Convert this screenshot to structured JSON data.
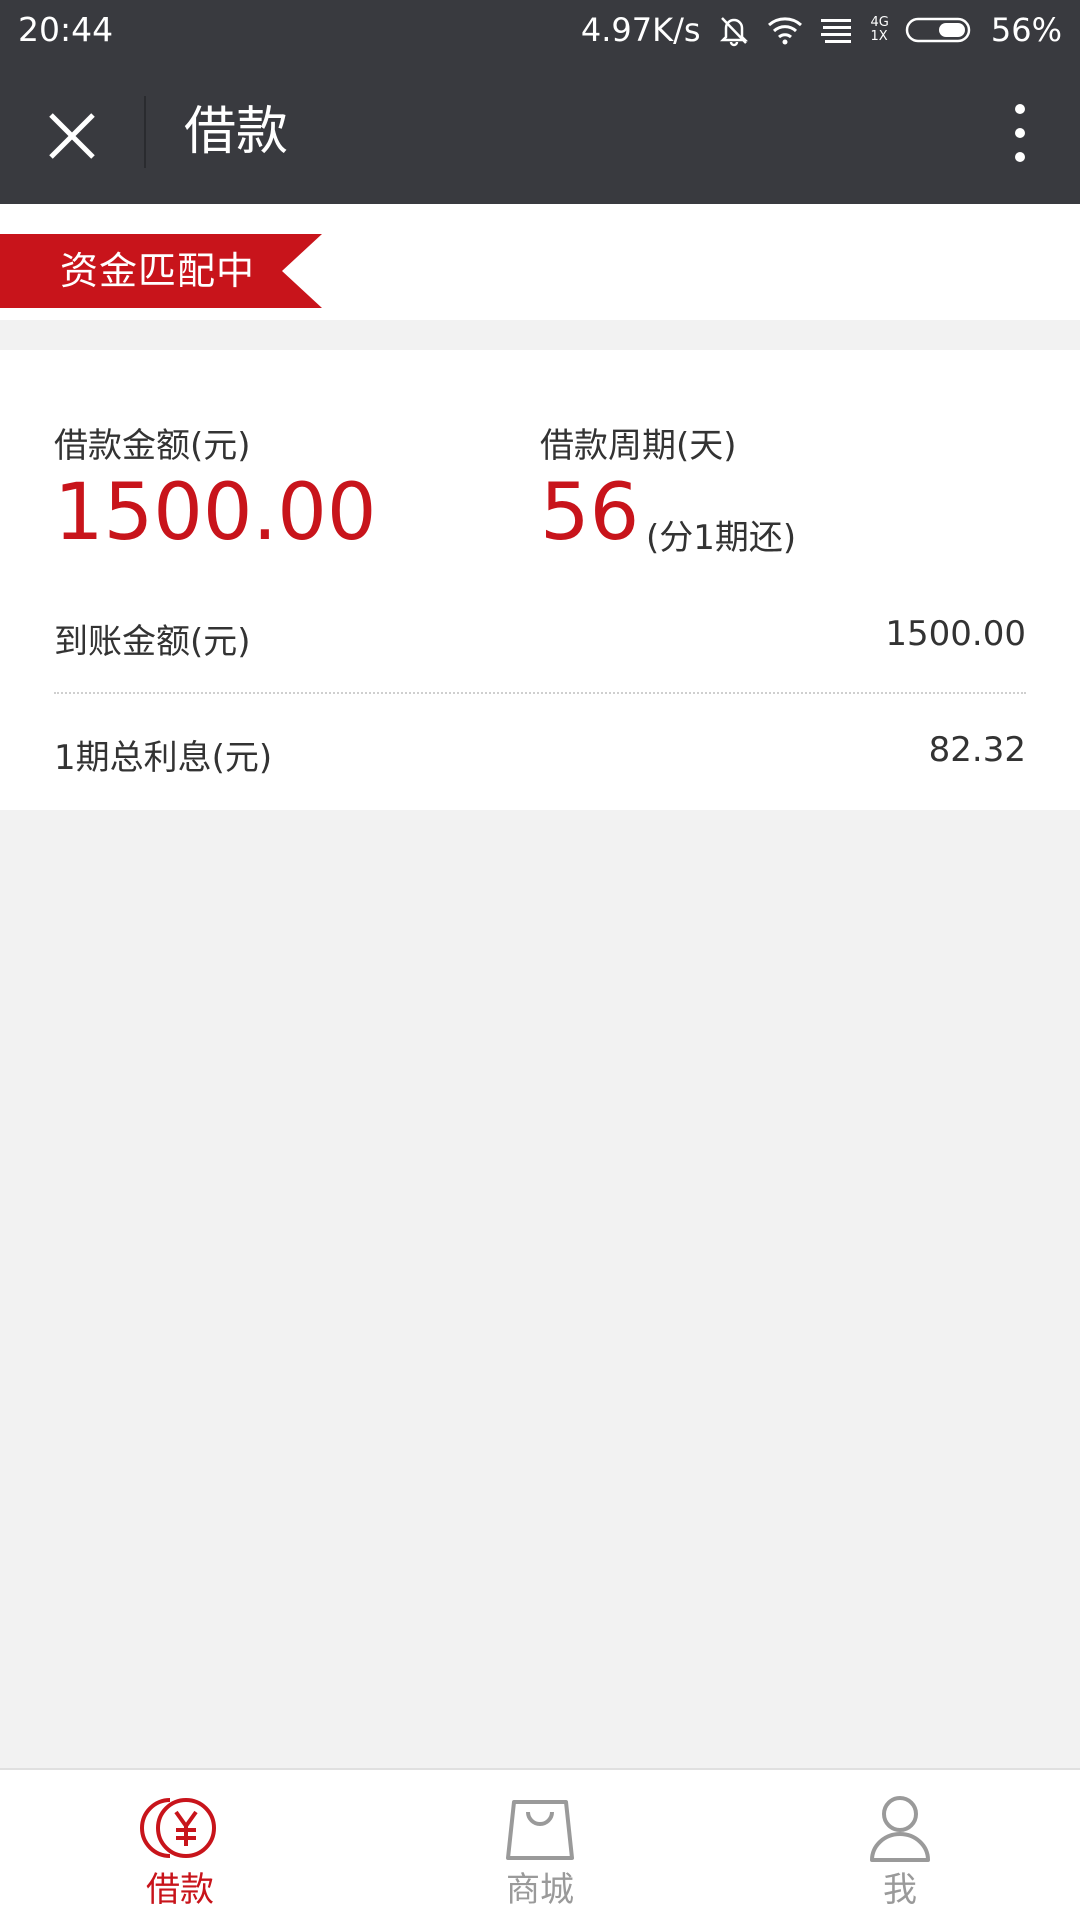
{
  "status_bar": {
    "time": "20:44",
    "net_speed": "4.97K/s",
    "network_type_top": "4G",
    "network_type_bottom": "1X",
    "battery": "56%"
  },
  "title_bar": {
    "title": "借款"
  },
  "status_ribbon": {
    "text": "资金匹配中",
    "color": "#c8141b"
  },
  "loan": {
    "amount_label": "借款金额(元)",
    "amount_value": "1500.00",
    "term_label": "借款周期(天)",
    "term_value": "56",
    "term_note": "(分1期还)",
    "received_label": "到账金额(元)",
    "received_value": "1500.00",
    "interest_label": "1期总利息(元)",
    "interest_value": "82.32"
  },
  "tab_bar": {
    "tabs": [
      {
        "label": "借款",
        "icon": "yuan-coin-icon",
        "active": true
      },
      {
        "label": "商城",
        "icon": "shopping-bag-icon",
        "active": false
      },
      {
        "label": "我",
        "icon": "person-icon",
        "active": false
      }
    ],
    "active_color": "#c8141b",
    "inactive_color": "#9a9a9a"
  }
}
